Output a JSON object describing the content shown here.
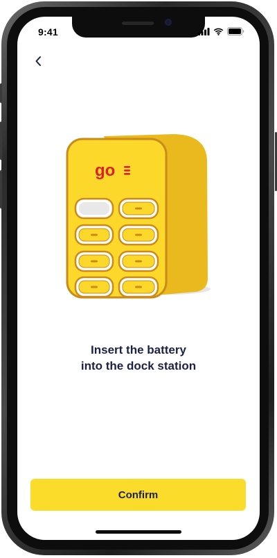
{
  "status_bar": {
    "time": "9:41",
    "icons": [
      "signal-icon",
      "wifi-icon",
      "battery-icon"
    ]
  },
  "header": {
    "back_icon": "chevron-left-icon"
  },
  "illustration": {
    "name": "dock-station-illustration",
    "logo_text": "go",
    "colors": {
      "body": "#fcd72a",
      "side": "#e5b41c",
      "outline": "#c98a1a",
      "logo": "#d8232a"
    }
  },
  "main": {
    "instruction_line1": "Insert the battery",
    "instruction_line2": "into the dock station"
  },
  "footer": {
    "confirm_label": "Confirm"
  },
  "colors": {
    "accent": "#fcdc2b",
    "text_primary": "#1b2245"
  }
}
